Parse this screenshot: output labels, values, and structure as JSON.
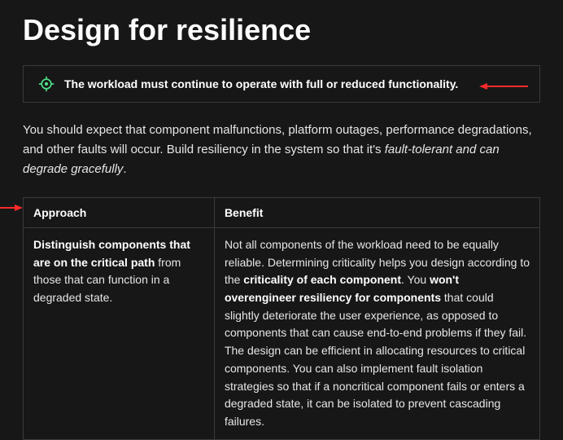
{
  "heading": "Design for resilience",
  "callout": {
    "text": "The workload must continue to operate with full or reduced functionality."
  },
  "intro": {
    "pre": "You should expect that component malfunctions, platform outages, performance degradations, and other faults will occur. Build resiliency in the system so that it's ",
    "em": "fault-tolerant and can degrade gracefully",
    "post": "."
  },
  "table": {
    "headers": {
      "approach": "Approach",
      "benefit": "Benefit"
    },
    "row": {
      "approach": {
        "strong": "Distinguish components that are on the critical path",
        "rest": " from those that can function in a degraded state."
      },
      "benefit": {
        "p1a": "Not all components of the workload need to be equally reliable. Determining criticality helps you design according to the ",
        "p1s1": "criticality of each component",
        "p1b": ". You ",
        "p1s2": "won't overengineer resiliency for components",
        "p1c": " that could slightly deteriorate the user experience, as opposed to components that can cause end-to-end problems if they fail.",
        "p2": "The design can be efficient in allocating resources to critical components. You can also implement fault isolation strategies so that if a noncritical component fails or enters a degraded state, it can be isolated to prevent cascading failures."
      }
    }
  }
}
